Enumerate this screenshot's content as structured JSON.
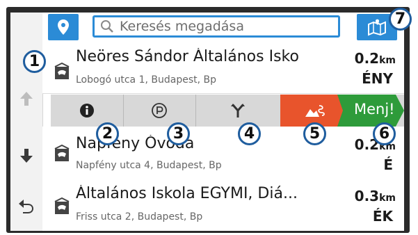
{
  "colors": {
    "accent": "#2b8bd6",
    "route": "#e8542c",
    "go": "#2e9b3a",
    "callout_ring": "#1f5d9e"
  },
  "search": {
    "placeholder": "Keresés megadása",
    "icon": "search-icon"
  },
  "top_buttons": {
    "left_icon": "location-pin-icon",
    "right_icon": "map-icon"
  },
  "results": [
    {
      "title": "Neöres Sándor Általános Isko",
      "address": "Lobogó utca 1, Budapest, Bp",
      "distance": "0.2",
      "unit": "km",
      "direction": "ÉNY"
    },
    {
      "title": "Napfény Óvoda",
      "address": "Napfény utca 4, Budapest, Bp",
      "distance": "0.2",
      "unit": "km",
      "direction": "É"
    },
    {
      "title": "Általános Iskola EGYMI, Diá...",
      "address": "Friss utca 2, Budapest, Bp",
      "distance": "0.3",
      "unit": "km",
      "direction": "ÉK"
    }
  ],
  "actions": {
    "info_icon": "info-icon",
    "parking_icon": "parking-icon",
    "fork_icon": "fork-icon",
    "route_icon": "route-icon",
    "go_label": "Menj!"
  },
  "left_nav": {
    "up": "arrow-up-icon",
    "down": "arrow-down-icon",
    "back": "back-icon"
  },
  "callouts": [
    "1",
    "2",
    "3",
    "4",
    "5",
    "6",
    "7"
  ]
}
